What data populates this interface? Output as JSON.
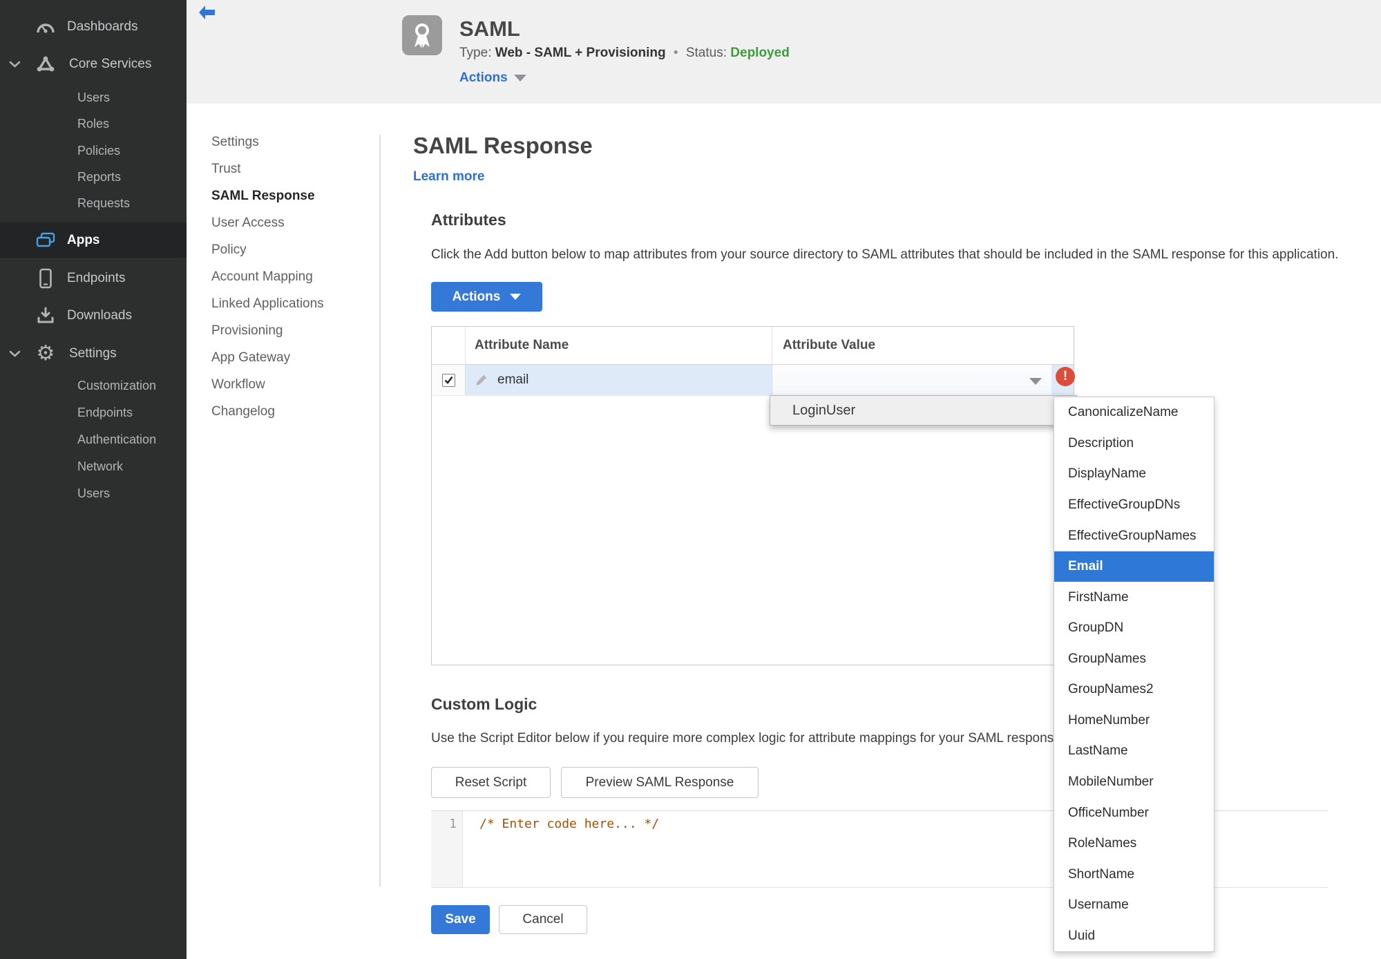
{
  "sidebar": {
    "dashboards": "Dashboards",
    "core_services": "Core Services",
    "core_children": [
      "Users",
      "Roles",
      "Policies",
      "Reports",
      "Requests"
    ],
    "apps": "Apps",
    "endpoints": "Endpoints",
    "downloads": "Downloads",
    "settings": "Settings",
    "settings_children": [
      "Customization",
      "Endpoints",
      "Authentication",
      "Network",
      "Users"
    ]
  },
  "header": {
    "app_title": "SAML",
    "type_label": "Type:",
    "type_value": "Web - SAML + Provisioning",
    "separator": "•",
    "status_label": "Status:",
    "status_value": "Deployed",
    "actions_label": "Actions"
  },
  "subnav": {
    "items": [
      "Settings",
      "Trust",
      "SAML Response",
      "User Access",
      "Policy",
      "Account Mapping",
      "Linked Applications",
      "Provisioning",
      "App Gateway",
      "Workflow",
      "Changelog"
    ],
    "active": "SAML Response"
  },
  "main": {
    "title": "SAML Response",
    "learn_more": "Learn more",
    "attributes": {
      "heading": "Attributes",
      "description": "Click the Add button below to map attributes from your source directory to SAML attributes that should be included in the SAML response for this application.",
      "actions_button": "Actions",
      "table": {
        "col_name": "Attribute Name",
        "col_value": "Attribute Value",
        "row": {
          "name": "email",
          "value": "",
          "checked": true,
          "error": true
        }
      },
      "value_menu": {
        "parent_item": "LoginUser",
        "selected": "Email",
        "submenu": [
          "CanonicalizeName",
          "Description",
          "DisplayName",
          "EffectiveGroupDNs",
          "EffectiveGroupNames",
          "Email",
          "FirstName",
          "GroupDN",
          "GroupNames",
          "GroupNames2",
          "HomeNumber",
          "LastName",
          "MobileNumber",
          "OfficeNumber",
          "RoleNames",
          "ShortName",
          "Username",
          "Uuid"
        ]
      }
    },
    "custom_logic": {
      "heading": "Custom Logic",
      "description": "Use the Script Editor below if you require more complex logic for attribute mappings for your SAML response.",
      "reset_button": "Reset Script",
      "preview_button": "Preview SAML Response",
      "editor": {
        "line_number": "1",
        "code": "/* Enter code here... */"
      }
    },
    "save_button": "Save",
    "cancel_button": "Cancel"
  },
  "colors": {
    "accent_blue": "#3478d8",
    "link_blue": "#2e6fd6",
    "selection_blue": "#2e79d8",
    "status_green": "#3d9a3d",
    "error_red": "#dd4b39",
    "sidebar_bg": "#2d2e2e",
    "header_bg": "#f0f0f0",
    "row_highlight": "#dfeaf8",
    "code_comment": "#a55000"
  }
}
